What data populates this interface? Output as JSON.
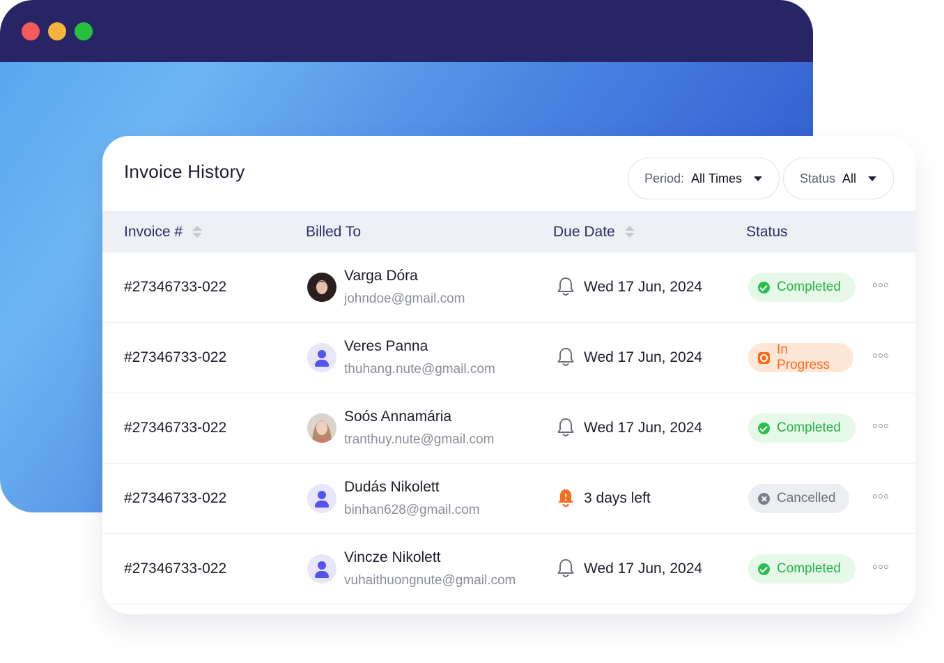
{
  "card": {
    "title": "Invoice History"
  },
  "filters": {
    "period": {
      "label": "Period:",
      "value": "All Times"
    },
    "status": {
      "label": "Status",
      "value": "All"
    }
  },
  "table": {
    "headers": {
      "invoice": "Invoice #",
      "billed_to": "Billed To",
      "due_date": "Due Date",
      "status": "Status"
    },
    "rows": [
      {
        "invoice": "#27346733-022",
        "name": "Varga Dóra",
        "email": "johndoe@gmail.com",
        "avatar": "photo",
        "due": "Wed 17 Jun, 2024",
        "due_icon": "bell-icon",
        "status": "Completed",
        "status_type": "completed"
      },
      {
        "invoice": "#27346733-022",
        "name": "Veres Panna",
        "email": "thuhang.nute@gmail.com",
        "avatar": "user-icon",
        "due": "Wed 17 Jun, 2024",
        "due_icon": "bell-icon",
        "status": "In Progress",
        "status_type": "progress"
      },
      {
        "invoice": "#27346733-022",
        "name": "Soós Annamária",
        "email": "tranthuy.nute@gmail.com",
        "avatar": "photo",
        "due": "Wed 17 Jun, 2024",
        "due_icon": "bell-icon",
        "status": "Completed",
        "status_type": "completed"
      },
      {
        "invoice": "#27346733-022",
        "name": "Dudás Nikolett",
        "email": "binhan628@gmail.com",
        "avatar": "user-icon",
        "due": "3 days left",
        "due_icon": "bell-alert-icon",
        "status": "Cancelled",
        "status_type": "cancelled"
      },
      {
        "invoice": "#27346733-022",
        "name": "Vincze Nikolett",
        "email": "vuhaithuongnute@gmail.com",
        "avatar": "user-icon",
        "due": "Wed 17 Jun, 2024",
        "due_icon": "bell-icon",
        "status": "Completed",
        "status_type": "completed"
      }
    ]
  },
  "colors": {
    "titlebar": "#272566",
    "header_text": "#2b2e6b",
    "completed": "#25b247",
    "in_progress": "#fb6b1c",
    "cancelled": "#6c707c",
    "alert": "#fb6b1c"
  }
}
